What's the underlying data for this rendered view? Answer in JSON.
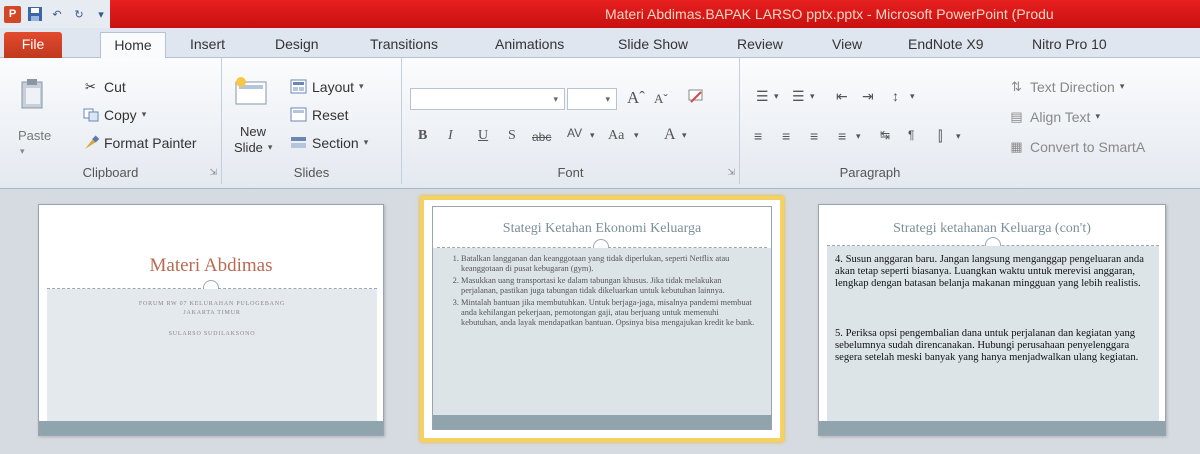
{
  "window": {
    "title": "Materi Abdimas.BAPAK LARSO pptx.pptx  -  Microsoft PowerPoint (Produ",
    "app_icon_letter": "P",
    "qat": [
      "save-icon",
      "undo-icon",
      "redo-icon",
      "customize-icon"
    ]
  },
  "tabs": [
    "File",
    "Home",
    "Insert",
    "Design",
    "Transitions",
    "Animations",
    "Slide Show",
    "Review",
    "View",
    "EndNote X9",
    "Nitro Pro 10"
  ],
  "ribbon": {
    "clipboard": {
      "label": "Clipboard",
      "paste": "Paste",
      "cut": "Cut",
      "copy": "Copy",
      "format_painter": "Format Painter"
    },
    "slides": {
      "label": "Slides",
      "new_slide": "New",
      "new_slide_2": "Slide",
      "layout": "Layout",
      "reset": "Reset",
      "section": "Section"
    },
    "font": {
      "label": "Font",
      "bold": "B",
      "italic": "I",
      "underline": "U",
      "strike": "S",
      "abc": "abc",
      "spacing": "AV",
      "case": "Aa",
      "color": "A"
    },
    "paragraph": {
      "label": "Paragraph",
      "text_direction": "Text Direction",
      "align_text": "Align Text",
      "convert_smartart": "Convert to SmartA"
    }
  },
  "slides": [
    {
      "title": "Materi Abdimas",
      "subtitle_line1": "FORUM RW 07 KELURAHAN PULOGEBANG",
      "subtitle_line2": "JAKARTA TIMUR",
      "author": "SULARSO SUDILAKSONO"
    },
    {
      "title": "Stategi Ketahan Ekonomi Keluarga",
      "items": [
        "Batalkan langganan dan keanggotaan yang tidak diperlukan, seperti Netflix atau keanggotaan di pusat kebugaran (gym).",
        "Masukkan uang transportasi ke dalam tabungan khusus. Jika tidak melakukan perjalanan, pastikan juga tabungan tidak dikeluarkan untuk kebutuhan lainnya.",
        "Mintalah bantuan jika membutuhkan. Untuk berjaga-jaga, misalnya pandemi membuat anda kehilangan pekerjaan, pemotongan gaji, atau berjuang untuk memenuhi kebutuhan, anda layak mendapatkan bantuan. Opsinya bisa mengajukan kredit ke bank."
      ]
    },
    {
      "title": "Strategi ketahanan Keluarga (con't)",
      "para1": "4. Susun anggaran baru. Jangan langsung menganggap pengeluaran anda akan tetap seperti biasanya. Luangkan waktu untuk merevisi anggaran, lengkap dengan batasan belanja makanan mingguan yang lebih realistis.",
      "para2": "5. Periksa opsi pengembalian dana untuk perjalanan dan kegiatan yang sebelumnya sudah direncanakan. Hubungi perusahaan penyelenggara segera setelah meski banyak yang hanya menjadwalkan ulang kegiatan."
    }
  ],
  "colors": {
    "title_bar": "#d91818",
    "file_tab": "#d24726",
    "selection": "#f4d161",
    "slide_accent": "#8fa4ad"
  }
}
